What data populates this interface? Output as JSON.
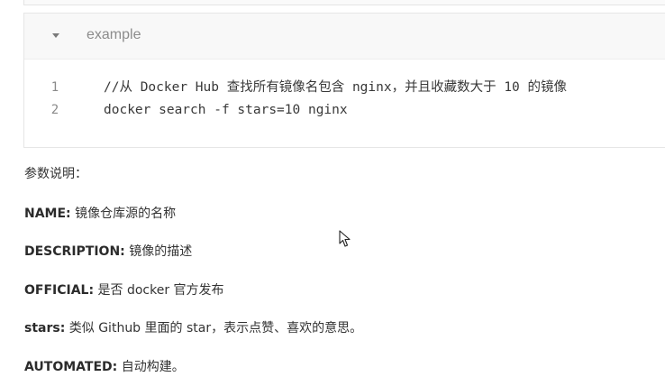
{
  "code_block": {
    "language": "example",
    "lines": [
      {
        "number": "1",
        "code": "//从 Docker Hub 查找所有镜像名包含 nginx，并且收藏数大于 10 的镜像"
      },
      {
        "number": "2",
        "code": "docker search -f stars=10 nginx"
      }
    ]
  },
  "params": {
    "heading": "参数说明：",
    "items": [
      {
        "key": "NAME:",
        "text": " 镜像仓库源的名称"
      },
      {
        "key": "DESCRIPTION:",
        "text": " 镜像的描述"
      },
      {
        "key": "OFFICIAL:",
        "text": " 是否 docker 官方发布"
      },
      {
        "key": "stars:",
        "text": " 类似 Github 里面的 star，表示点赞、喜欢的意思。"
      },
      {
        "key": "AUTOMATED:",
        "text": " 自动构建。"
      }
    ]
  },
  "colors": {
    "code_header_bg": "#f8f8f8",
    "border": "#e6e6e6",
    "line_number": "#8a8a8a",
    "text": "#333333"
  },
  "icons": {
    "collapse": "caret-down-icon",
    "pointer": "mouse-cursor-icon"
  }
}
